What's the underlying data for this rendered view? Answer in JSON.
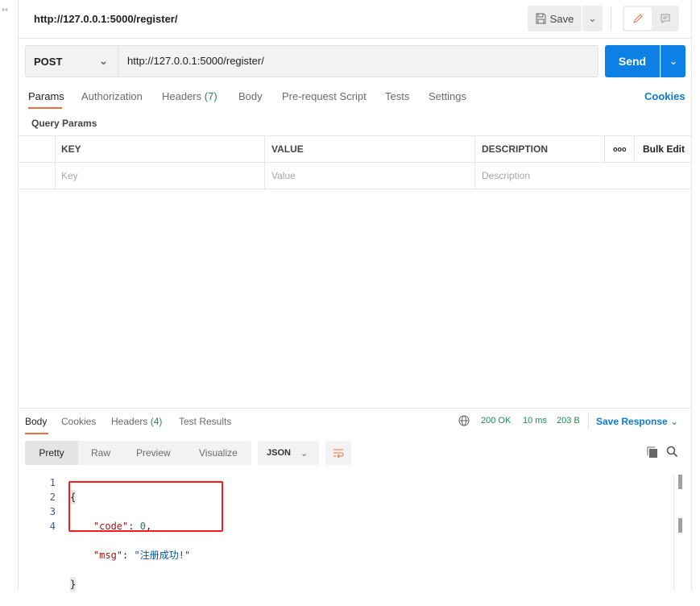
{
  "sidebar": {
    "dots": "°°"
  },
  "header": {
    "title": "http://127.0.0.1:5000/register/",
    "save_label": "Save"
  },
  "request": {
    "method": "POST",
    "url": "http://127.0.0.1:5000/register/",
    "send_label": "Send"
  },
  "tabs": [
    {
      "label": "Params"
    },
    {
      "label": "Authorization"
    },
    {
      "label": "Headers",
      "count": "(7)"
    },
    {
      "label": "Body"
    },
    {
      "label": "Pre-request Script"
    },
    {
      "label": "Tests"
    },
    {
      "label": "Settings"
    }
  ],
  "cookies_link": "Cookies",
  "query_params": {
    "title": "Query Params",
    "columns": [
      "KEY",
      "VALUE",
      "DESCRIPTION"
    ],
    "more": "ooo",
    "bulk_edit": "Bulk Edit",
    "placeholders": [
      "Key",
      "Value",
      "Description"
    ]
  },
  "response": {
    "tabs": [
      {
        "label": "Body"
      },
      {
        "label": "Cookies"
      },
      {
        "label": "Headers",
        "count": "(4)"
      },
      {
        "label": "Test Results"
      }
    ],
    "status": "200 OK",
    "time": "10 ms",
    "size": "203 B",
    "save_response": "Save Response",
    "views": [
      "Pretty",
      "Raw",
      "Preview",
      "Visualize"
    ],
    "format": "JSON",
    "lines": [
      "1",
      "2",
      "3",
      "4"
    ],
    "code": {
      "open": "{",
      "k1": "\"code\"",
      "v1": "0",
      "k2": "\"msg\"",
      "v2": "\"注册成功!\"",
      "close": "}"
    }
  },
  "colors": {
    "accent": "#0d7bd6",
    "send": "#0d80e6",
    "tab_underline": "#f26b3a",
    "highlight_box": "#ff1a1a",
    "status_green": "#1f8a4c"
  }
}
